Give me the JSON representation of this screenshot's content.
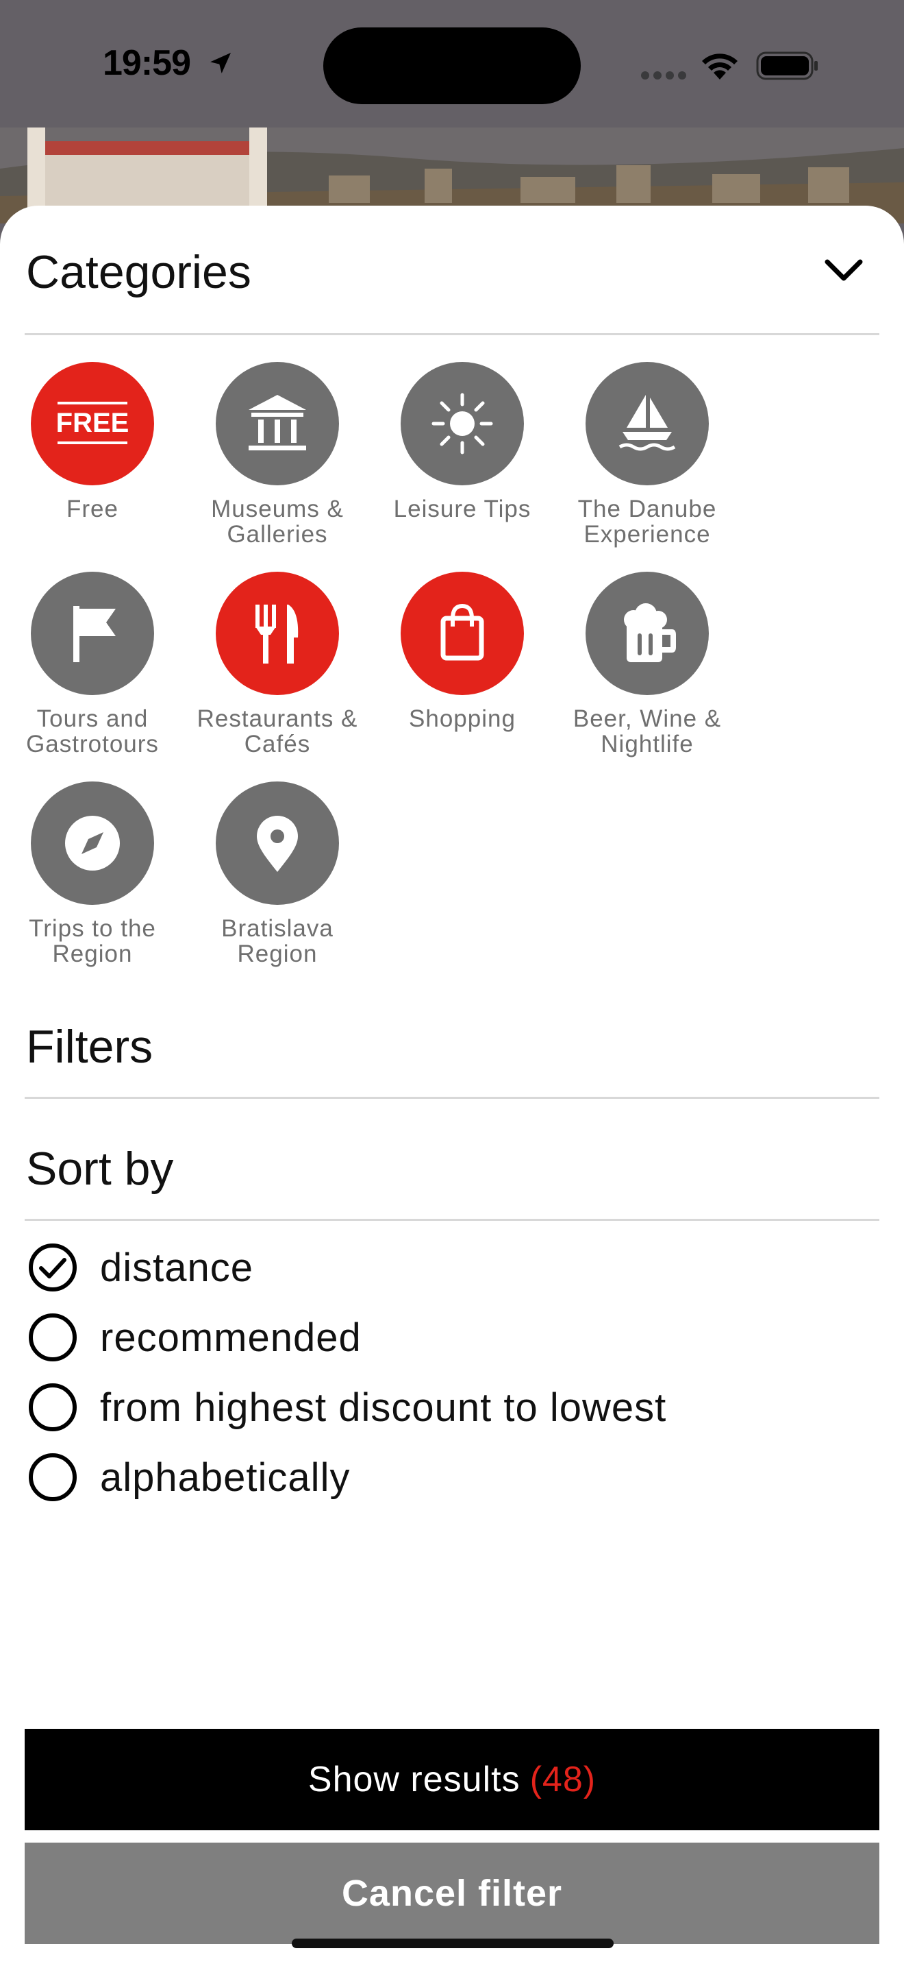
{
  "status_bar": {
    "time": "19:59"
  },
  "categories": {
    "title": "Categories",
    "items": [
      {
        "label": "Free",
        "icon": "free-icon",
        "selected": true,
        "badge_text": "FREE"
      },
      {
        "label": "Museums & Galleries",
        "icon": "museum-icon",
        "selected": false
      },
      {
        "label": "Leisure Tips",
        "icon": "sun-icon",
        "selected": false
      },
      {
        "label": "The Danube Experience",
        "icon": "sailboat-icon",
        "selected": false
      },
      {
        "label": "Tours and Gastrotours",
        "icon": "flag-icon",
        "selected": false
      },
      {
        "label": "Restaurants & Cafés",
        "icon": "fork-knife-icon",
        "selected": true
      },
      {
        "label": "Shopping",
        "icon": "shopping-bag-icon",
        "selected": true
      },
      {
        "label": "Beer, Wine & Nightlife",
        "icon": "beer-mug-icon",
        "selected": false
      },
      {
        "label": "Trips to the Region",
        "icon": "compass-icon",
        "selected": false
      },
      {
        "label": "Bratislava Region",
        "icon": "map-pin-icon",
        "selected": false
      }
    ]
  },
  "filters": {
    "title": "Filters"
  },
  "sort": {
    "title": "Sort by",
    "options": [
      {
        "label": "distance",
        "checked": true
      },
      {
        "label": "recommended",
        "checked": false
      },
      {
        "label": "from highest discount to lowest",
        "checked": false
      },
      {
        "label": "alphabetically",
        "checked": false
      }
    ]
  },
  "actions": {
    "show_results_label": "Show results",
    "show_results_count": "(48)",
    "cancel_label": "Cancel filter"
  },
  "colors": {
    "accent": "#e3231b",
    "inactive": "#6f6f6f",
    "overlay": "#646066"
  }
}
